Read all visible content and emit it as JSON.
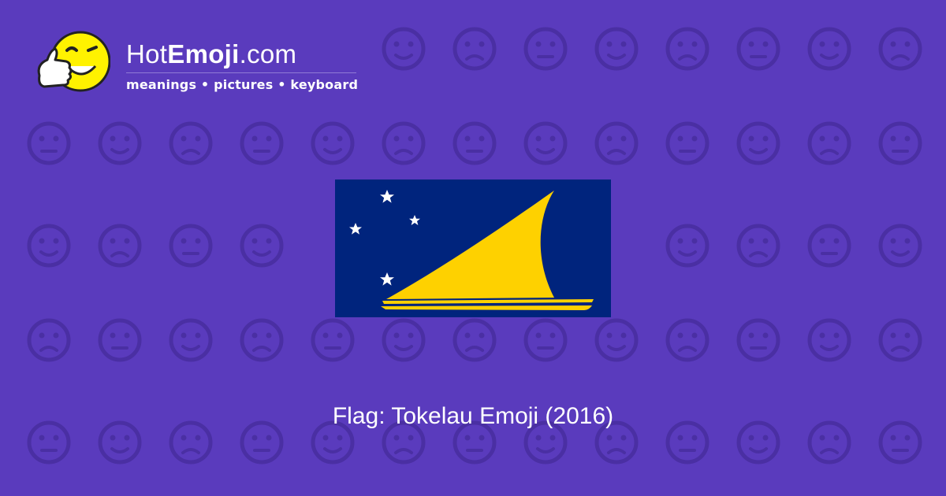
{
  "site": {
    "name_prefix": "Hot",
    "name_bold": "Emoji",
    "name_suffix": ".com",
    "tagline": "meanings • pictures • keyboard"
  },
  "emoji": {
    "caption": "Flag: Tokelau Emoji (2016)",
    "flag_icon": "tokelau-flag-icon"
  },
  "colors": {
    "background": "#5a3bbd",
    "pattern": "#4a2fa3",
    "flag_blue": "#00247d",
    "flag_yellow": "#fed100",
    "logo_yellow": "#fff200"
  }
}
